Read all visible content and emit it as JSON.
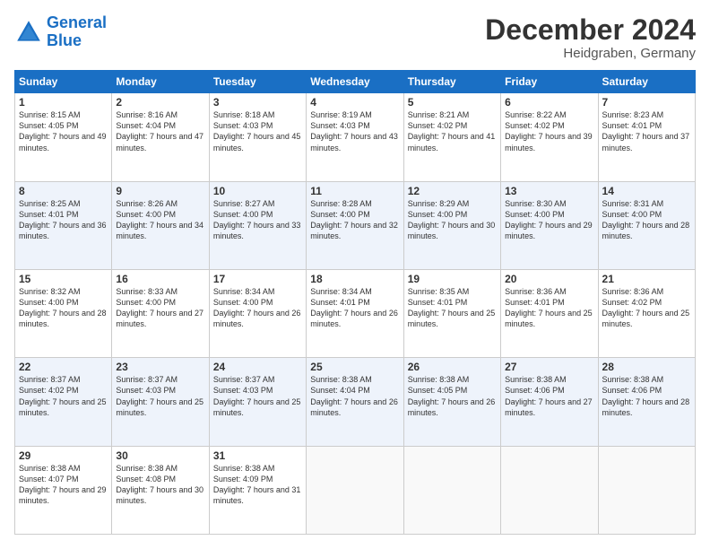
{
  "header": {
    "logo_line1": "General",
    "logo_line2": "Blue",
    "title": "December 2024",
    "subtitle": "Heidgraben, Germany"
  },
  "calendar": {
    "days_of_week": [
      "Sunday",
      "Monday",
      "Tuesday",
      "Wednesday",
      "Thursday",
      "Friday",
      "Saturday"
    ],
    "weeks": [
      [
        null,
        {
          "day": 2,
          "sunrise": "8:16 AM",
          "sunset": "4:04 PM",
          "daylight": "7 hours and 47 minutes."
        },
        {
          "day": 3,
          "sunrise": "8:18 AM",
          "sunset": "4:03 PM",
          "daylight": "7 hours and 45 minutes."
        },
        {
          "day": 4,
          "sunrise": "8:19 AM",
          "sunset": "4:03 PM",
          "daylight": "7 hours and 43 minutes."
        },
        {
          "day": 5,
          "sunrise": "8:21 AM",
          "sunset": "4:02 PM",
          "daylight": "7 hours and 41 minutes."
        },
        {
          "day": 6,
          "sunrise": "8:22 AM",
          "sunset": "4:02 PM",
          "daylight": "7 hours and 39 minutes."
        },
        {
          "day": 7,
          "sunrise": "8:23 AM",
          "sunset": "4:01 PM",
          "daylight": "7 hours and 37 minutes."
        }
      ],
      [
        {
          "day": 1,
          "sunrise": "8:15 AM",
          "sunset": "4:05 PM",
          "daylight": "7 hours and 49 minutes."
        },
        null,
        null,
        null,
        null,
        null,
        null
      ],
      [
        {
          "day": 8,
          "sunrise": "8:25 AM",
          "sunset": "4:01 PM",
          "daylight": "7 hours and 36 minutes."
        },
        {
          "day": 9,
          "sunrise": "8:26 AM",
          "sunset": "4:00 PM",
          "daylight": "7 hours and 34 minutes."
        },
        {
          "day": 10,
          "sunrise": "8:27 AM",
          "sunset": "4:00 PM",
          "daylight": "7 hours and 33 minutes."
        },
        {
          "day": 11,
          "sunrise": "8:28 AM",
          "sunset": "4:00 PM",
          "daylight": "7 hours and 32 minutes."
        },
        {
          "day": 12,
          "sunrise": "8:29 AM",
          "sunset": "4:00 PM",
          "daylight": "7 hours and 30 minutes."
        },
        {
          "day": 13,
          "sunrise": "8:30 AM",
          "sunset": "4:00 PM",
          "daylight": "7 hours and 29 minutes."
        },
        {
          "day": 14,
          "sunrise": "8:31 AM",
          "sunset": "4:00 PM",
          "daylight": "7 hours and 28 minutes."
        }
      ],
      [
        {
          "day": 15,
          "sunrise": "8:32 AM",
          "sunset": "4:00 PM",
          "daylight": "7 hours and 28 minutes."
        },
        {
          "day": 16,
          "sunrise": "8:33 AM",
          "sunset": "4:00 PM",
          "daylight": "7 hours and 27 minutes."
        },
        {
          "day": 17,
          "sunrise": "8:34 AM",
          "sunset": "4:00 PM",
          "daylight": "7 hours and 26 minutes."
        },
        {
          "day": 18,
          "sunrise": "8:34 AM",
          "sunset": "4:01 PM",
          "daylight": "7 hours and 26 minutes."
        },
        {
          "day": 19,
          "sunrise": "8:35 AM",
          "sunset": "4:01 PM",
          "daylight": "7 hours and 25 minutes."
        },
        {
          "day": 20,
          "sunrise": "8:36 AM",
          "sunset": "4:01 PM",
          "daylight": "7 hours and 25 minutes."
        },
        {
          "day": 21,
          "sunrise": "8:36 AM",
          "sunset": "4:02 PM",
          "daylight": "7 hours and 25 minutes."
        }
      ],
      [
        {
          "day": 22,
          "sunrise": "8:37 AM",
          "sunset": "4:02 PM",
          "daylight": "7 hours and 25 minutes."
        },
        {
          "day": 23,
          "sunrise": "8:37 AM",
          "sunset": "4:03 PM",
          "daylight": "7 hours and 25 minutes."
        },
        {
          "day": 24,
          "sunrise": "8:37 AM",
          "sunset": "4:03 PM",
          "daylight": "7 hours and 25 minutes."
        },
        {
          "day": 25,
          "sunrise": "8:38 AM",
          "sunset": "4:04 PM",
          "daylight": "7 hours and 26 minutes."
        },
        {
          "day": 26,
          "sunrise": "8:38 AM",
          "sunset": "4:05 PM",
          "daylight": "7 hours and 26 minutes."
        },
        {
          "day": 27,
          "sunrise": "8:38 AM",
          "sunset": "4:06 PM",
          "daylight": "7 hours and 27 minutes."
        },
        {
          "day": 28,
          "sunrise": "8:38 AM",
          "sunset": "4:06 PM",
          "daylight": "7 hours and 28 minutes."
        }
      ],
      [
        {
          "day": 29,
          "sunrise": "8:38 AM",
          "sunset": "4:07 PM",
          "daylight": "7 hours and 29 minutes."
        },
        {
          "day": 30,
          "sunrise": "8:38 AM",
          "sunset": "4:08 PM",
          "daylight": "7 hours and 30 minutes."
        },
        {
          "day": 31,
          "sunrise": "8:38 AM",
          "sunset": "4:09 PM",
          "daylight": "7 hours and 31 minutes."
        },
        null,
        null,
        null,
        null
      ]
    ]
  }
}
